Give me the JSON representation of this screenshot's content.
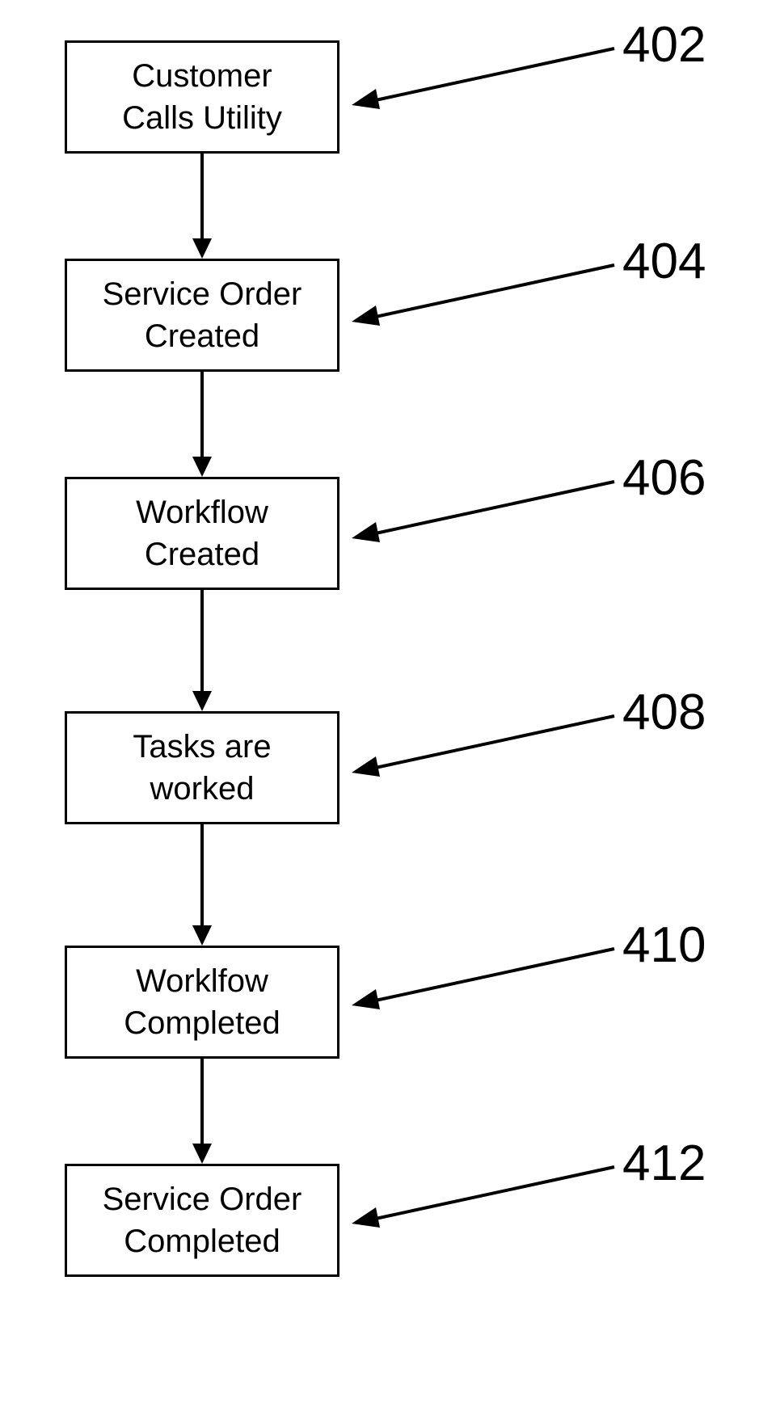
{
  "nodes": [
    {
      "line1": "Customer",
      "line2": "Calls Utility",
      "ref": "402"
    },
    {
      "line1": "Service Order",
      "line2": "Created",
      "ref": "404"
    },
    {
      "line1": "Workflow",
      "line2": "Created",
      "ref": "406"
    },
    {
      "line1": "Tasks are",
      "line2": "worked",
      "ref": "408"
    },
    {
      "line1": "Worklfow",
      "line2": "Completed",
      "ref": "410"
    },
    {
      "line1": "Service Order",
      "line2": "Completed",
      "ref": "412"
    }
  ]
}
